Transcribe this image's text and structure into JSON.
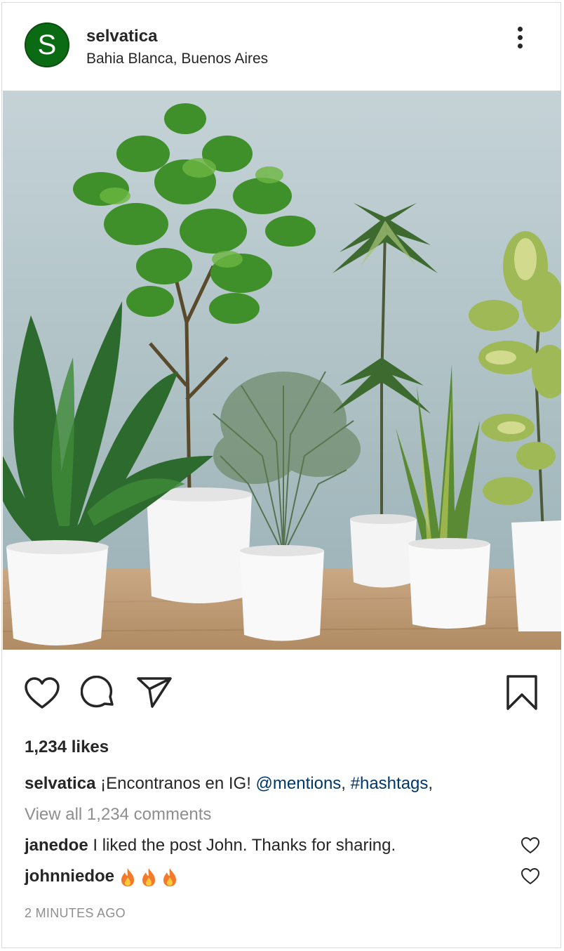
{
  "post": {
    "username": "selvatica",
    "avatar_letter": "S",
    "location": "Bahia Blanca, Buenos Aires",
    "likes": "1,234 likes",
    "caption": {
      "username": "selvatica",
      "text": " ¡Encontranos en IG! ",
      "mentions": "@mentions",
      "sep1": ", ",
      "hashtags": "#hashtags",
      "sep2": ","
    },
    "view_all": "View all 1,234 comments",
    "comments": [
      {
        "username": "janedoe",
        "text": " I liked the post John. Thanks for sharing."
      },
      {
        "username": "johnniedoe",
        "text": ""
      }
    ],
    "timestamp": "2 MINUTES AGO"
  },
  "colors": {
    "avatar_bg": "#0b6b14",
    "link": "#00376b",
    "muted": "#8e8e8e",
    "text": "#262626"
  },
  "icons": [
    "more-options-icon",
    "heart-icon",
    "comment-icon",
    "share-icon",
    "bookmark-icon",
    "fire-emoji-icon"
  ]
}
